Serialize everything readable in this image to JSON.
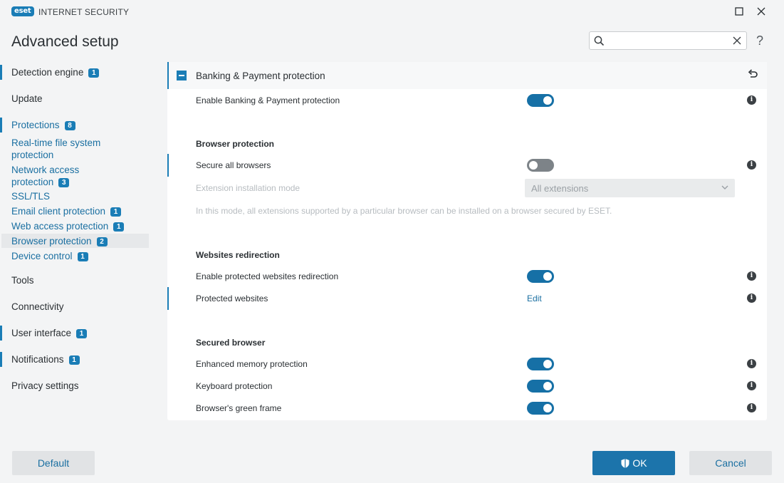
{
  "window": {
    "logo": "eset",
    "app_name": "INTERNET SECURITY",
    "maximize_icon": "maximize-icon",
    "close_icon": "close-icon"
  },
  "header": {
    "title": "Advanced setup",
    "search": {
      "value": "",
      "placeholder": ""
    },
    "help_label": "?"
  },
  "sidebar": {
    "items": [
      {
        "label": "Detection engine",
        "badge": "1",
        "type": "top"
      },
      {
        "label": "Update",
        "badge": "",
        "type": "top"
      },
      {
        "label": "Protections",
        "badge": "8",
        "type": "sub"
      },
      {
        "label": "Real-time file system",
        "label2": "protection",
        "badge": "",
        "type": "sub"
      },
      {
        "label": "Network access",
        "label2": "protection",
        "badge": "3",
        "type": "sub"
      },
      {
        "label": "SSL/TLS",
        "badge": "",
        "type": "sub"
      },
      {
        "label": "Email client protection",
        "badge": "1",
        "type": "sub"
      },
      {
        "label": "Web access protection",
        "badge": "1",
        "type": "sub"
      },
      {
        "label": "Browser protection",
        "badge": "2",
        "type": "sub",
        "selected": true
      },
      {
        "label": "Device control",
        "badge": "1",
        "type": "sub"
      },
      {
        "label": "Tools",
        "badge": "",
        "type": "top"
      },
      {
        "label": "Connectivity",
        "badge": "",
        "type": "top"
      },
      {
        "label": "User interface",
        "badge": "1",
        "type": "top"
      },
      {
        "label": "Notifications",
        "badge": "1",
        "type": "top"
      },
      {
        "label": "Privacy settings",
        "badge": "",
        "type": "top"
      }
    ]
  },
  "panel": {
    "title": "Banking & Payment protection",
    "enable_label": "Enable Banking & Payment protection",
    "enable_state": "on",
    "browser_protection": {
      "title": "Browser protection",
      "secure_all_label": "Secure all browsers",
      "secure_all_state": "off",
      "extension_mode_label": "Extension installation mode",
      "extension_mode_value": "All extensions",
      "note": "In this mode, all extensions supported by a particular browser can be installed on a browser secured by ESET."
    },
    "websites_redirection": {
      "title": "Websites redirection",
      "enable_label": "Enable protected websites redirection",
      "enable_state": "on",
      "protected_label": "Protected websites",
      "edit_label": "Edit"
    },
    "secured_browser": {
      "title": "Secured browser",
      "memory_label": "Enhanced memory protection",
      "memory_state": "on",
      "keyboard_label": "Keyboard protection",
      "keyboard_state": "on",
      "frame_label": "Browser's green frame",
      "frame_state": "on"
    },
    "info_glyph": "i"
  },
  "footer": {
    "default_label": "Default",
    "ok_label": "OK",
    "cancel_label": "Cancel"
  },
  "colors": {
    "accent": "#1a7db6",
    "toggle_on": "#1670a6",
    "toggle_off": "#7d8388",
    "link": "#1a6fa1"
  }
}
